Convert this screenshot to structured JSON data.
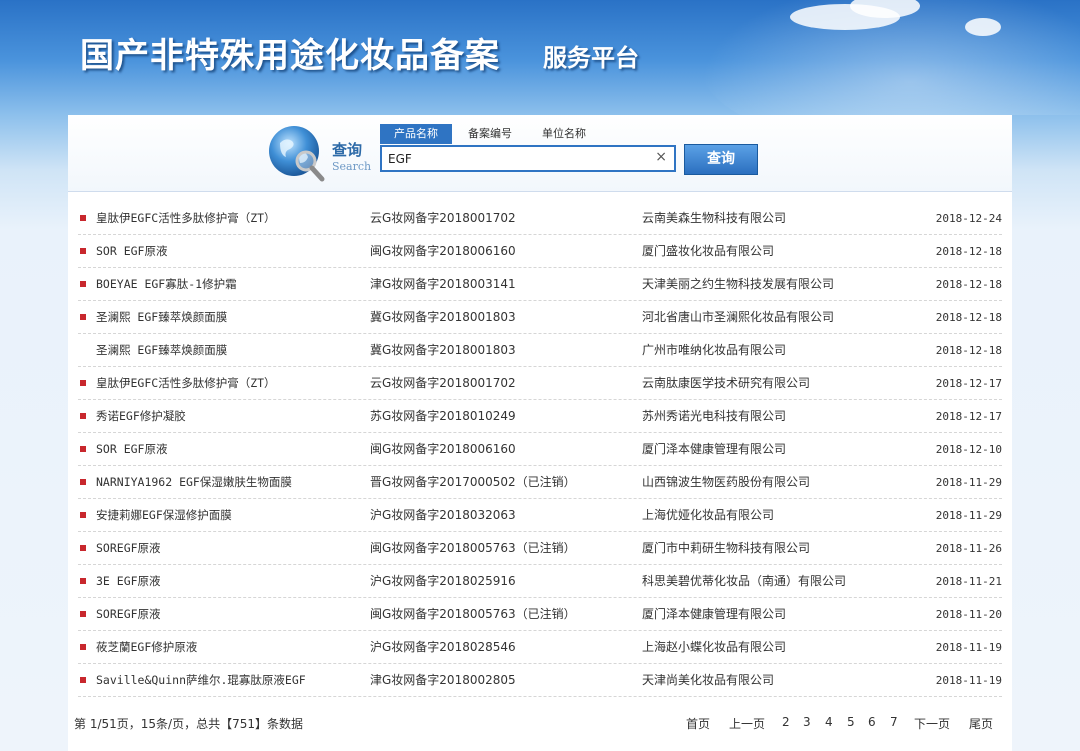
{
  "header": {
    "title": "国产非特殊用途化妆品备案",
    "subtitle": "服务平台"
  },
  "search": {
    "label": "查询",
    "label_en": "Search",
    "tabs": [
      "产品名称",
      "备案编号",
      "单位名称"
    ],
    "active_tab": 0,
    "value": "EGF",
    "clear_glyph": "×",
    "button_label": "查询"
  },
  "results": [
    {
      "bullet": true,
      "name": "皇肽伊EGFC活性多肽修护膏（ZT）",
      "number": "云G妆网备字2018001702",
      "company": "云南美森生物科技有限公司",
      "date": "2018-12-24"
    },
    {
      "bullet": true,
      "name": "SOR EGF原液",
      "number": "闽G妆网备字2018006160",
      "company": "厦门盛妆化妆品有限公司",
      "date": "2018-12-18"
    },
    {
      "bullet": true,
      "name": "BOEYAE EGF寡肽-1修护霜",
      "number": "津G妆网备字2018003141",
      "company": "天津美丽之约生物科技发展有限公司",
      "date": "2018-12-18"
    },
    {
      "bullet": true,
      "name": "圣澜熙 EGF臻萃焕颜面膜",
      "number": "冀G妆网备字2018001803",
      "company": "河北省唐山市圣澜熙化妆品有限公司",
      "date": "2018-12-18"
    },
    {
      "bullet": false,
      "name": "圣澜熙 EGF臻萃焕颜面膜",
      "number": "冀G妆网备字2018001803",
      "company": "广州市唯纳化妆品有限公司",
      "date": "2018-12-18"
    },
    {
      "bullet": true,
      "name": "皇肽伊EGFC活性多肽修护膏（ZT）",
      "number": "云G妆网备字2018001702",
      "company": "云南肽康医学技术研究有限公司",
      "date": "2018-12-17"
    },
    {
      "bullet": true,
      "name": "秀诺EGF修护凝胶",
      "number": "苏G妆网备字2018010249",
      "company": "苏州秀诺光电科技有限公司",
      "date": "2018-12-17"
    },
    {
      "bullet": true,
      "name": "SOR EGF原液",
      "number": "闽G妆网备字2018006160",
      "company": "厦门泽本健康管理有限公司",
      "date": "2018-12-10"
    },
    {
      "bullet": true,
      "name": "NARNIYA1962 EGF保湿嫩肤生物面膜",
      "number": "晋G妆网备字2017000502（已注销）",
      "company": "山西锦波生物医药股份有限公司",
      "date": "2018-11-29"
    },
    {
      "bullet": true,
      "name": "安捷莉娜EGF保湿修护面膜",
      "number": "沪G妆网备字2018032063",
      "company": "上海优娅化妆品有限公司",
      "date": "2018-11-29"
    },
    {
      "bullet": true,
      "name": "SOREGF原液",
      "number": "闽G妆网备字2018005763（已注销）",
      "company": "厦门市中莉研生物科技有限公司",
      "date": "2018-11-26"
    },
    {
      "bullet": true,
      "name": "3E EGF原液",
      "number": "沪G妆网备字2018025916",
      "company": "科思美碧优蒂化妆品（南通）有限公司",
      "date": "2018-11-21"
    },
    {
      "bullet": true,
      "name": "SOREGF原液",
      "number": "闽G妆网备字2018005763（已注销）",
      "company": "厦门泽本健康管理有限公司",
      "date": "2018-11-20"
    },
    {
      "bullet": true,
      "name": "莜芝蘭EGF修护原液",
      "number": "沪G妆网备字2018028546",
      "company": "上海赵小蝶化妆品有限公司",
      "date": "2018-11-19"
    },
    {
      "bullet": true,
      "name": "Saville&Quinn萨维尔.琨寡肽原液EGF",
      "number": "津G妆网备字2018002805",
      "company": "天津尚美化妆品有限公司",
      "date": "2018-11-19"
    }
  ],
  "pagination": {
    "info": "第 1/51页，15条/页，总共【751】条数据",
    "first": "首页",
    "prev": "上一页",
    "pages": [
      "2",
      "3",
      "4",
      "5",
      "6",
      "7"
    ],
    "next": "下一页",
    "last": "尾页"
  },
  "colors": {
    "accent": "#2f74c3",
    "bullet": "#c8272d"
  }
}
